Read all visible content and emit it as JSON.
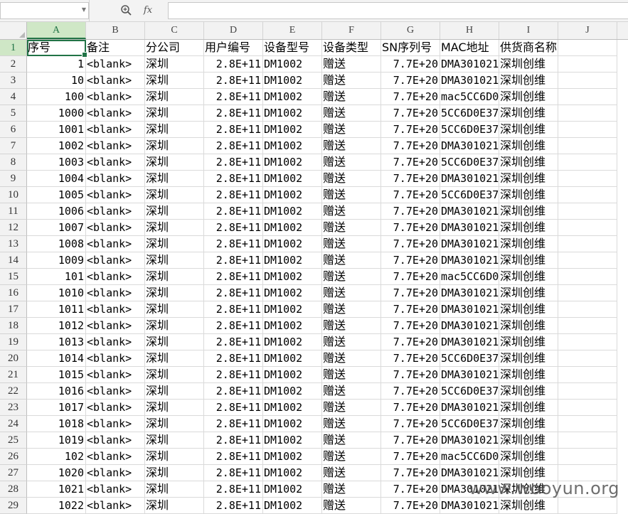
{
  "formula_bar": {
    "name_box": "",
    "formula": "",
    "fx_label": "fx"
  },
  "columns": [
    "A",
    "B",
    "C",
    "D",
    "E",
    "F",
    "G",
    "H",
    "I",
    "J"
  ],
  "selected_column": "A",
  "selected_row": "1",
  "header_row": {
    "row_num": "1",
    "cells": [
      "序号",
      "备注",
      "分公司",
      "用户编号",
      "设备型号",
      "设备类型",
      "SN序列号",
      "MAC地址",
      "供货商名称"
    ]
  },
  "rows": [
    {
      "row_num": "2",
      "seq": "1",
      "note": "<blank>",
      "branch": "深圳",
      "user": "2.8E+11",
      "model": "DM1002",
      "type": "赠送",
      "sn": "7.7E+20",
      "mac": "DMA301021",
      "vendor": "深圳创维"
    },
    {
      "row_num": "3",
      "seq": "10",
      "note": "<blank>",
      "branch": "深圳",
      "user": "2.8E+11",
      "model": "DM1002",
      "type": "赠送",
      "sn": "7.7E+20",
      "mac": "DMA301021",
      "vendor": "深圳创维"
    },
    {
      "row_num": "4",
      "seq": "100",
      "note": "<blank>",
      "branch": "深圳",
      "user": "2.8E+11",
      "model": "DM1002",
      "type": "赠送",
      "sn": "7.7E+20",
      "mac": "mac5CC6D0",
      "vendor": "深圳创维"
    },
    {
      "row_num": "5",
      "seq": "1000",
      "note": "<blank>",
      "branch": "深圳",
      "user": "2.8E+11",
      "model": "DM1002",
      "type": "赠送",
      "sn": "7.7E+20",
      "mac": "5CC6D0E37",
      "vendor": "深圳创维"
    },
    {
      "row_num": "6",
      "seq": "1001",
      "note": "<blank>",
      "branch": "深圳",
      "user": "2.8E+11",
      "model": "DM1002",
      "type": "赠送",
      "sn": "7.7E+20",
      "mac": "5CC6D0E37",
      "vendor": "深圳创维"
    },
    {
      "row_num": "7",
      "seq": "1002",
      "note": "<blank>",
      "branch": "深圳",
      "user": "2.8E+11",
      "model": "DM1002",
      "type": "赠送",
      "sn": "7.7E+20",
      "mac": "DMA301021",
      "vendor": "深圳创维"
    },
    {
      "row_num": "8",
      "seq": "1003",
      "note": "<blank>",
      "branch": "深圳",
      "user": "2.8E+11",
      "model": "DM1002",
      "type": "赠送",
      "sn": "7.7E+20",
      "mac": "5CC6D0E37",
      "vendor": "深圳创维"
    },
    {
      "row_num": "9",
      "seq": "1004",
      "note": "<blank>",
      "branch": "深圳",
      "user": "2.8E+11",
      "model": "DM1002",
      "type": "赠送",
      "sn": "7.7E+20",
      "mac": "DMA301021",
      "vendor": "深圳创维"
    },
    {
      "row_num": "10",
      "seq": "1005",
      "note": "<blank>",
      "branch": "深圳",
      "user": "2.8E+11",
      "model": "DM1002",
      "type": "赠送",
      "sn": "7.7E+20",
      "mac": "5CC6D0E37",
      "vendor": "深圳创维"
    },
    {
      "row_num": "11",
      "seq": "1006",
      "note": "<blank>",
      "branch": "深圳",
      "user": "2.8E+11",
      "model": "DM1002",
      "type": "赠送",
      "sn": "7.7E+20",
      "mac": "DMA301021",
      "vendor": "深圳创维"
    },
    {
      "row_num": "12",
      "seq": "1007",
      "note": "<blank>",
      "branch": "深圳",
      "user": "2.8E+11",
      "model": "DM1002",
      "type": "赠送",
      "sn": "7.7E+20",
      "mac": "DMA301021",
      "vendor": "深圳创维"
    },
    {
      "row_num": "13",
      "seq": "1008",
      "note": "<blank>",
      "branch": "深圳",
      "user": "2.8E+11",
      "model": "DM1002",
      "type": "赠送",
      "sn": "7.7E+20",
      "mac": "DMA301021",
      "vendor": "深圳创维"
    },
    {
      "row_num": "14",
      "seq": "1009",
      "note": "<blank>",
      "branch": "深圳",
      "user": "2.8E+11",
      "model": "DM1002",
      "type": "赠送",
      "sn": "7.7E+20",
      "mac": "DMA301021",
      "vendor": "深圳创维"
    },
    {
      "row_num": "15",
      "seq": "101",
      "note": "<blank>",
      "branch": "深圳",
      "user": "2.8E+11",
      "model": "DM1002",
      "type": "赠送",
      "sn": "7.7E+20",
      "mac": "mac5CC6D0",
      "vendor": "深圳创维"
    },
    {
      "row_num": "16",
      "seq": "1010",
      "note": "<blank>",
      "branch": "深圳",
      "user": "2.8E+11",
      "model": "DM1002",
      "type": "赠送",
      "sn": "7.7E+20",
      "mac": "DMA301021",
      "vendor": "深圳创维"
    },
    {
      "row_num": "17",
      "seq": "1011",
      "note": "<blank>",
      "branch": "深圳",
      "user": "2.8E+11",
      "model": "DM1002",
      "type": "赠送",
      "sn": "7.7E+20",
      "mac": "DMA301021",
      "vendor": "深圳创维"
    },
    {
      "row_num": "18",
      "seq": "1012",
      "note": "<blank>",
      "branch": "深圳",
      "user": "2.8E+11",
      "model": "DM1002",
      "type": "赠送",
      "sn": "7.7E+20",
      "mac": "DMA301021",
      "vendor": "深圳创维"
    },
    {
      "row_num": "19",
      "seq": "1013",
      "note": "<blank>",
      "branch": "深圳",
      "user": "2.8E+11",
      "model": "DM1002",
      "type": "赠送",
      "sn": "7.7E+20",
      "mac": "DMA301021",
      "vendor": "深圳创维"
    },
    {
      "row_num": "20",
      "seq": "1014",
      "note": "<blank>",
      "branch": "深圳",
      "user": "2.8E+11",
      "model": "DM1002",
      "type": "赠送",
      "sn": "7.7E+20",
      "mac": "5CC6D0E37",
      "vendor": "深圳创维"
    },
    {
      "row_num": "21",
      "seq": "1015",
      "note": "<blank>",
      "branch": "深圳",
      "user": "2.8E+11",
      "model": "DM1002",
      "type": "赠送",
      "sn": "7.7E+20",
      "mac": "DMA301021",
      "vendor": "深圳创维"
    },
    {
      "row_num": "22",
      "seq": "1016",
      "note": "<blank>",
      "branch": "深圳",
      "user": "2.8E+11",
      "model": "DM1002",
      "type": "赠送",
      "sn": "7.7E+20",
      "mac": "5CC6D0E37",
      "vendor": "深圳创维"
    },
    {
      "row_num": "23",
      "seq": "1017",
      "note": "<blank>",
      "branch": "深圳",
      "user": "2.8E+11",
      "model": "DM1002",
      "type": "赠送",
      "sn": "7.7E+20",
      "mac": "DMA301021",
      "vendor": "深圳创维"
    },
    {
      "row_num": "24",
      "seq": "1018",
      "note": "<blank>",
      "branch": "深圳",
      "user": "2.8E+11",
      "model": "DM1002",
      "type": "赠送",
      "sn": "7.7E+20",
      "mac": "5CC6D0E37",
      "vendor": "深圳创维"
    },
    {
      "row_num": "25",
      "seq": "1019",
      "note": "<blank>",
      "branch": "深圳",
      "user": "2.8E+11",
      "model": "DM1002",
      "type": "赠送",
      "sn": "7.7E+20",
      "mac": "DMA301021",
      "vendor": "深圳创维"
    },
    {
      "row_num": "26",
      "seq": "102",
      "note": "<blank>",
      "branch": "深圳",
      "user": "2.8E+11",
      "model": "DM1002",
      "type": "赠送",
      "sn": "7.7E+20",
      "mac": "mac5CC6D0",
      "vendor": "深圳创维"
    },
    {
      "row_num": "27",
      "seq": "1020",
      "note": "<blank>",
      "branch": "深圳",
      "user": "2.8E+11",
      "model": "DM1002",
      "type": "赠送",
      "sn": "7.7E+20",
      "mac": "DMA301021",
      "vendor": "深圳创维"
    },
    {
      "row_num": "28",
      "seq": "1021",
      "note": "<blank>",
      "branch": "深圳",
      "user": "2.8E+11",
      "model": "DM1002",
      "type": "赠送",
      "sn": "7.7E+20",
      "mac": "DMA301021",
      "vendor": "深圳创维"
    },
    {
      "row_num": "29",
      "seq": "1022",
      "note": "<blank>",
      "branch": "深圳",
      "user": "2.8E+11",
      "model": "DM1002",
      "type": "赠送",
      "sn": "7.7E+20",
      "mac": "DMA301021",
      "vendor": "深圳创维"
    }
  ],
  "watermark": "www.wooyun.org",
  "colors": {
    "accent": "#217346",
    "header_bg": "#f2f2f2",
    "selected_header_bg": "#cfe7c6",
    "gridline": "#dadada"
  }
}
